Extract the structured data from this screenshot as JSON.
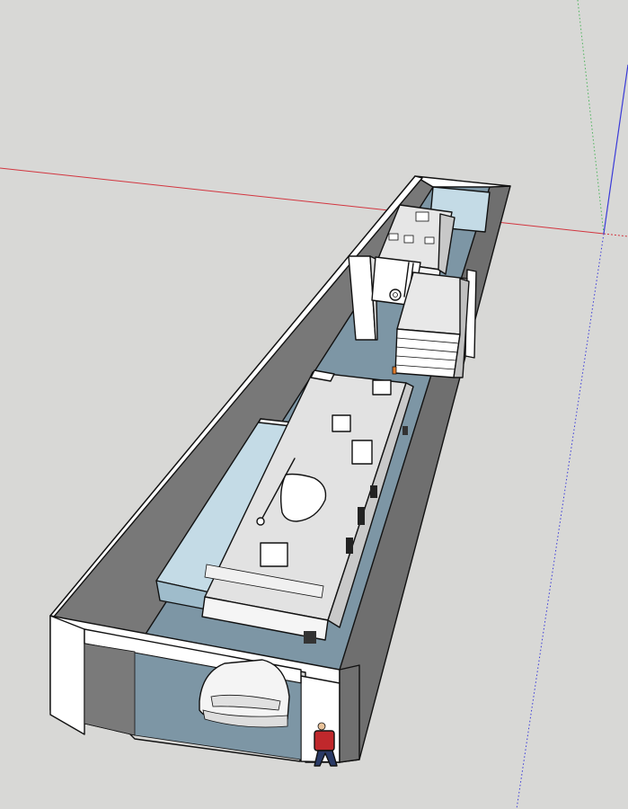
{
  "canvas": {
    "background_color": "#d8d8d6"
  },
  "axes": {
    "red_axis_color": "#d2353f",
    "green_axis_color": "#4bb35a",
    "blue_axis_color": "#3a3ad8"
  },
  "materials": {
    "wall_outer_color": "#ffffff",
    "wall_inner_color": "#777777",
    "floor_color": "#7d96a5",
    "glass_panel_color": "#c4dbe6",
    "vehicle_body_color": "#f2f2f2",
    "vehicle_roof_color": "#dcdcdc",
    "figure_shirt_color": "#c0282c",
    "figure_pants_color": "#2a3a66"
  },
  "scene_objects": [
    "garage-building",
    "rv-motorhome",
    "rv-fifth-wheel",
    "cargo-trailer",
    "car",
    "scale-figure"
  ]
}
